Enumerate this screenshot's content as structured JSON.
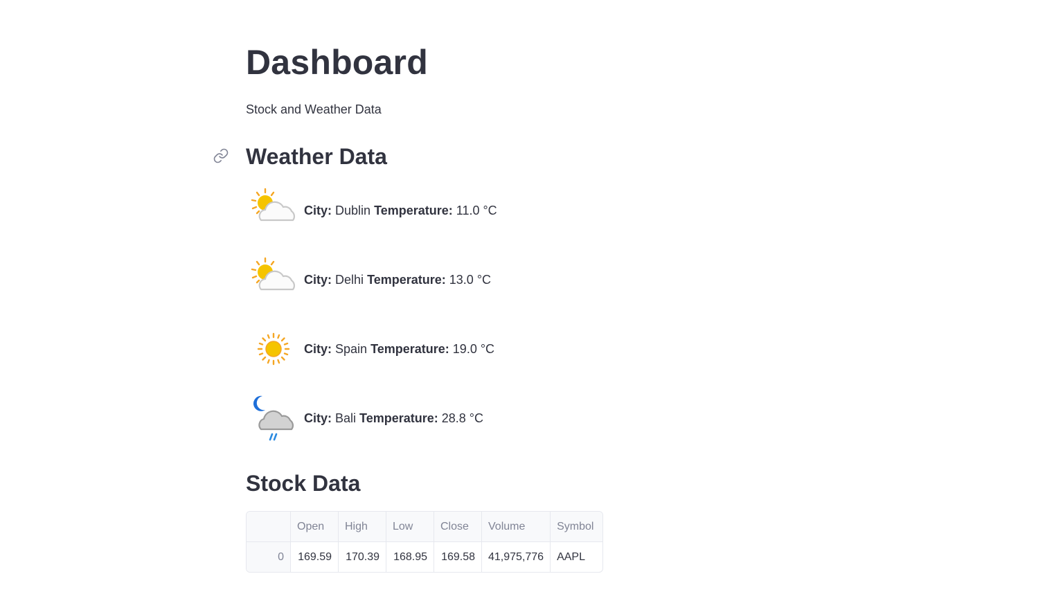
{
  "page": {
    "title": "Dashboard",
    "subtitle": "Stock and Weather Data"
  },
  "weather": {
    "heading": "Weather Data",
    "city_label": "City:",
    "temp_label": "Temperature:",
    "items": [
      {
        "city": "Dublin",
        "temperature": "11.0 °C",
        "icon": "partly-sunny-icon"
      },
      {
        "city": "Delhi",
        "temperature": "13.0 °C",
        "icon": "partly-sunny-icon"
      },
      {
        "city": "Spain",
        "temperature": "19.0 °C",
        "icon": "sun-icon"
      },
      {
        "city": "Bali",
        "temperature": "28.8 °C",
        "icon": "night-rain-icon"
      }
    ]
  },
  "stock": {
    "heading": "Stock Data",
    "columns": [
      "",
      "Open",
      "High",
      "Low",
      "Close",
      "Volume",
      "Symbol"
    ],
    "rows": [
      [
        "0",
        "169.59",
        "170.39",
        "168.95",
        "169.58",
        "41,975,776",
        "AAPL"
      ]
    ]
  },
  "colors": {
    "text": "#31333f",
    "muted": "#808495",
    "border": "#e6e8ee",
    "sun": "#f5c400",
    "sun_rays": "#f5a623",
    "cloud_stroke": "#c8c8c8",
    "moon": "#1e6fd9",
    "rain": "#2b8ae0"
  }
}
